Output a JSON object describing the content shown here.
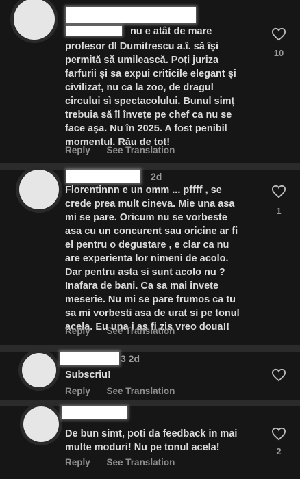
{
  "comments": [
    {
      "username_fragment": "nu e atât de mare",
      "text_lines": [
        "profesor dl Dumitrescu a.î. să își",
        "permită să umilească. Poți juriza",
        "farfurii și sa expui criticile elegant și",
        "civilizat, nu ca la zoo, de dragul",
        "circului sì spectacolului. Bunul simț",
        "trebuia să îl învețe pe chef ca nu se",
        "face așa. Nu în 2025. A fost penibil",
        "momentul. Rău de tot!"
      ],
      "reply_label": "Reply",
      "translate_label": "See Translation",
      "likes": "10"
    },
    {
      "time": "2d",
      "text_lines": [
        "Florentinnn e un omm ... pffff , se",
        "crede prea mult cineva. Mie una asa",
        "mi se pare. Oricum nu se vorbeste",
        "asa cu un concurent sau oricine ar fi",
        "el pentru o degustare , e clar ca nu",
        "are experienta lor nimeni de acolo.",
        "Dar pentru  asta si sunt acolo nu ?",
        "Inafara de bani.  Ca sa mai invete",
        "meserie. Nu mi se pare frumos ca tu",
        "sa mi vorbesti asa de urat si pe tonul",
        "acela. Eu una i as fi zis vreo doua!!"
      ],
      "reply_label": "Reply",
      "translate_label": "See Translation",
      "likes": "1"
    },
    {
      "time": "3 2d",
      "text_lines": [
        "Subscriu!"
      ],
      "reply_label": "Reply",
      "translate_label": "See Translation",
      "likes": ""
    },
    {
      "text_lines": [
        "De bun simt, poti da feedback in mai",
        "multe moduri! Nu pe tonul acela!"
      ],
      "reply_label": "Reply",
      "translate_label": "See Translation",
      "likes": "2"
    }
  ]
}
